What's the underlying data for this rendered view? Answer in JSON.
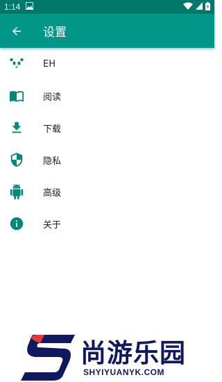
{
  "status_bar": {
    "time": "1:14"
  },
  "app_bar": {
    "title": "设置"
  },
  "settings": {
    "items": [
      {
        "label": "EH",
        "icon": "panda-icon"
      },
      {
        "label": "阅读",
        "icon": "book-icon"
      },
      {
        "label": "下载",
        "icon": "download-icon"
      },
      {
        "label": "隐私",
        "icon": "shield-icon"
      },
      {
        "label": "高级",
        "icon": "android-icon"
      },
      {
        "label": "关于",
        "icon": "info-icon"
      }
    ]
  },
  "watermark": {
    "title": "尚游乐园",
    "subtitle": "SHYIYUANYK.COM"
  },
  "colors": {
    "primary": "#009688",
    "primary_dark": "#00796b",
    "accent": "#00897b"
  }
}
